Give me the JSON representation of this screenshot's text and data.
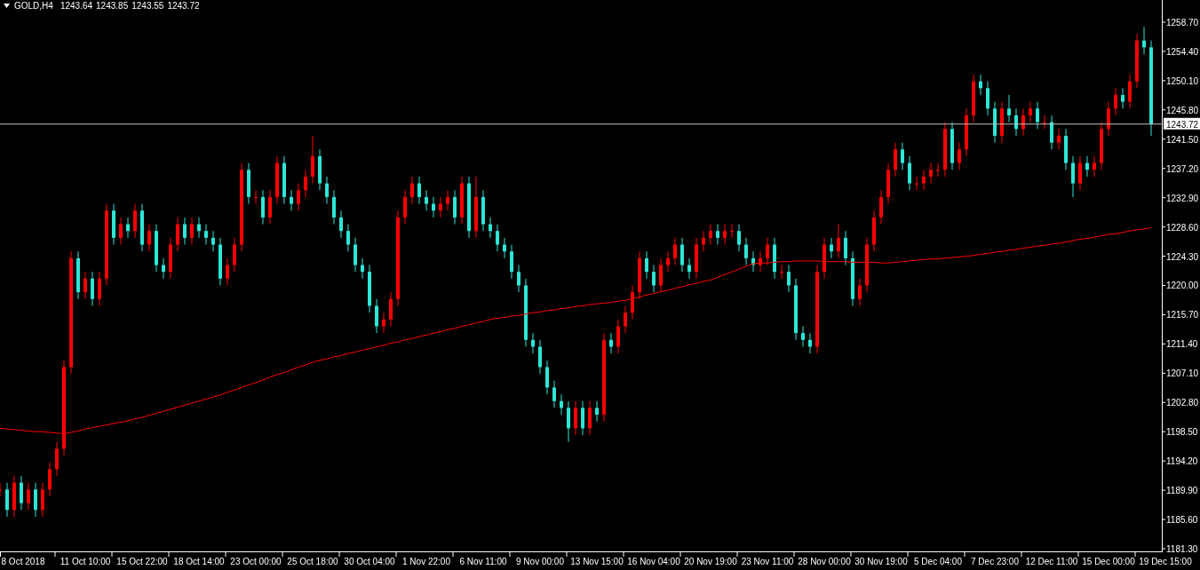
{
  "header": {
    "symbol": "GOLD,H4",
    "quotes": [
      "1243.64",
      "1243.85",
      "1243.55",
      "1243.72"
    ]
  },
  "chart_data": {
    "type": "candlestick",
    "ylim": [
      1180.78,
      1261.96
    ],
    "categories": [
      null,
      null,
      null,
      "8 Oct 2018",
      null,
      null,
      null,
      null,
      null,
      null,
      null,
      null,
      "11 Oct 10:00",
      null,
      null,
      null,
      null,
      null,
      null,
      null,
      "15 Oct 22:00",
      null,
      null,
      null,
      null,
      null,
      null,
      null,
      "18 Oct 14:00",
      null,
      null,
      null,
      null,
      null,
      null,
      null,
      "23 Oct 00:00",
      null,
      null,
      null,
      null,
      null,
      null,
      null,
      "25 Oct 18:00",
      null,
      null,
      null,
      null,
      null,
      null,
      null,
      "30 Oct 04:00",
      null,
      null,
      null,
      null,
      null,
      null,
      null,
      "1 Nov 22:00",
      null,
      null,
      null,
      null,
      null,
      null,
      null,
      "6 Nov 11:00",
      null,
      null,
      null,
      null,
      null,
      null,
      null,
      "9 Nov 00:00",
      null,
      null,
      null,
      null,
      null,
      null,
      null,
      "13 Nov 15:00",
      null,
      null,
      null,
      null,
      null,
      null,
      null,
      "16 Nov 04:00",
      null,
      null,
      null,
      null,
      null,
      null,
      null,
      "20 Nov 19:00",
      null,
      null,
      null,
      null,
      null,
      null,
      null,
      "23 Nov 11:00",
      null,
      null,
      null,
      null,
      null,
      null,
      null,
      "28 Nov 00:00",
      null,
      null,
      null,
      null,
      null,
      null,
      null,
      "30 Nov 19:00",
      null,
      null,
      null,
      null,
      null,
      null,
      null,
      "5 Dec 04:00",
      null,
      null,
      null,
      null,
      null,
      null,
      null,
      "7 Dec 23:00",
      null,
      null,
      null,
      null,
      null,
      null,
      null,
      "12 Dec 11:00",
      null,
      null,
      null,
      null,
      null,
      null,
      null,
      "15 Dec 00:00",
      null,
      null,
      null,
      null,
      null,
      null,
      null,
      "19 Dec 15:00"
    ],
    "ohlc": [
      [
        1190,
        1191,
        1189,
        1190
      ],
      [
        1190,
        1191,
        1186,
        1187
      ],
      [
        1187,
        1192,
        1186,
        1191
      ],
      [
        1191,
        1192,
        1187,
        1188
      ],
      [
        1188,
        1191,
        1187,
        1190
      ],
      [
        1190,
        1191,
        1186,
        1187
      ],
      [
        1187,
        1191,
        1186,
        1190
      ],
      [
        1190,
        1194,
        1189,
        1193
      ],
      [
        1193,
        1197,
        1192,
        1196
      ],
      [
        1196,
        1209,
        1195,
        1208
      ],
      [
        1208,
        1225,
        1207,
        1224
      ],
      [
        1224,
        1225,
        1218,
        1219
      ],
      [
        1219,
        1222,
        1218,
        1221
      ],
      [
        1221,
        1222,
        1217,
        1218
      ],
      [
        1218,
        1222,
        1217,
        1221
      ],
      [
        1221,
        1232,
        1220,
        1231
      ],
      [
        1231,
        1232,
        1226,
        1227
      ],
      [
        1227,
        1230,
        1226,
        1229
      ],
      [
        1229,
        1230,
        1227,
        1228
      ],
      [
        1228,
        1232,
        1227,
        1231
      ],
      [
        1231,
        1232,
        1225,
        1226
      ],
      [
        1226,
        1229,
        1225,
        1228
      ],
      [
        1228,
        1229,
        1222,
        1223
      ],
      [
        1223,
        1224,
        1221,
        1222
      ],
      [
        1222,
        1227,
        1221,
        1226
      ],
      [
        1226,
        1230,
        1225,
        1229
      ],
      [
        1229,
        1230,
        1226,
        1227
      ],
      [
        1227,
        1230,
        1226,
        1229
      ],
      [
        1229,
        1230,
        1227,
        1228
      ],
      [
        1228,
        1229,
        1226,
        1227
      ],
      [
        1227,
        1228,
        1225,
        1226
      ],
      [
        1226,
        1227,
        1220,
        1221
      ],
      [
        1221,
        1224,
        1220,
        1223
      ],
      [
        1223,
        1227,
        1222,
        1226
      ],
      [
        1226,
        1238,
        1225,
        1237
      ],
      [
        1237,
        1238,
        1232,
        1233
      ],
      [
        1233,
        1234,
        1232,
        1233
      ],
      [
        1233,
        1234,
        1229,
        1230
      ],
      [
        1230,
        1234,
        1229,
        1233
      ],
      [
        1233,
        1239,
        1232,
        1238
      ],
      [
        1238,
        1239,
        1232,
        1233
      ],
      [
        1233,
        1234,
        1231,
        1232
      ],
      [
        1232,
        1235,
        1231,
        1234
      ],
      [
        1234,
        1237,
        1233,
        1236
      ],
      [
        1236,
        1242,
        1235,
        1239
      ],
      [
        1239,
        1240,
        1234,
        1235
      ],
      [
        1235,
        1236,
        1232,
        1233
      ],
      [
        1233,
        1234,
        1229,
        1230
      ],
      [
        1230,
        1231,
        1227,
        1228
      ],
      [
        1228,
        1229,
        1225,
        1226
      ],
      [
        1226,
        1227,
        1222,
        1223
      ],
      [
        1223,
        1224,
        1221,
        1222
      ],
      [
        1222,
        1223,
        1216,
        1217
      ],
      [
        1217,
        1218,
        1213,
        1214
      ],
      [
        1214,
        1216,
        1213,
        1215
      ],
      [
        1215,
        1219,
        1214,
        1218
      ],
      [
        1218,
        1231,
        1217,
        1230
      ],
      [
        1230,
        1234,
        1229,
        1233
      ],
      [
        1233,
        1236,
        1232,
        1235
      ],
      [
        1235,
        1236,
        1232,
        1233
      ],
      [
        1233,
        1234,
        1231,
        1232
      ],
      [
        1232,
        1233,
        1230,
        1231
      ],
      [
        1231,
        1233,
        1230,
        1232
      ],
      [
        1232,
        1234,
        1231,
        1233
      ],
      [
        1233,
        1234,
        1229,
        1230
      ],
      [
        1230,
        1236,
        1229,
        1235
      ],
      [
        1235,
        1236,
        1227,
        1228
      ],
      [
        1228,
        1236,
        1227,
        1233
      ],
      [
        1233,
        1234,
        1228,
        1229
      ],
      [
        1229,
        1230,
        1227,
        1228
      ],
      [
        1228,
        1229,
        1225,
        1226
      ],
      [
        1226,
        1227,
        1224,
        1225
      ],
      [
        1225,
        1226,
        1221,
        1222
      ],
      [
        1222,
        1223,
        1219,
        1220
      ],
      [
        1220,
        1221,
        1211,
        1212
      ],
      [
        1212,
        1213,
        1210,
        1211
      ],
      [
        1211,
        1212,
        1207,
        1208
      ],
      [
        1208,
        1209,
        1204,
        1205
      ],
      [
        1205,
        1206,
        1202,
        1203
      ],
      [
        1203,
        1204,
        1201,
        1202
      ],
      [
        1202,
        1203,
        1197,
        1199
      ],
      [
        1199,
        1203,
        1198,
        1202
      ],
      [
        1202,
        1203,
        1198,
        1199
      ],
      [
        1199,
        1203,
        1198,
        1202
      ],
      [
        1202,
        1203,
        1200,
        1201
      ],
      [
        1201,
        1213,
        1200,
        1212
      ],
      [
        1212,
        1213,
        1210,
        1211
      ],
      [
        1211,
        1215,
        1210,
        1214
      ],
      [
        1214,
        1217,
        1213,
        1216
      ],
      [
        1216,
        1220,
        1215,
        1219
      ],
      [
        1219,
        1225,
        1218,
        1224
      ],
      [
        1224,
        1225,
        1221,
        1222
      ],
      [
        1222,
        1223,
        1219,
        1220
      ],
      [
        1220,
        1224,
        1219,
        1223
      ],
      [
        1223,
        1225,
        1222,
        1224
      ],
      [
        1224,
        1227,
        1223,
        1226
      ],
      [
        1226,
        1227,
        1222,
        1223
      ],
      [
        1223,
        1224,
        1221,
        1222
      ],
      [
        1222,
        1227,
        1221,
        1226
      ],
      [
        1226,
        1228,
        1225,
        1227
      ],
      [
        1227,
        1229,
        1226,
        1228
      ],
      [
        1228,
        1229,
        1226,
        1227
      ],
      [
        1227,
        1229,
        1226,
        1228
      ],
      [
        1228,
        1229,
        1227,
        1228
      ],
      [
        1228,
        1229,
        1225,
        1226
      ],
      [
        1226,
        1227,
        1223,
        1224
      ],
      [
        1224,
        1225,
        1222,
        1223
      ],
      [
        1223,
        1225,
        1222,
        1224
      ],
      [
        1224,
        1227,
        1223,
        1226
      ],
      [
        1226,
        1227,
        1221,
        1222
      ],
      [
        1222,
        1223,
        1221,
        1222
      ],
      [
        1222,
        1223,
        1219,
        1220
      ],
      [
        1220,
        1221,
        1212,
        1213
      ],
      [
        1213,
        1214,
        1211,
        1212
      ],
      [
        1212,
        1213,
        1210,
        1211
      ],
      [
        1211,
        1223,
        1210,
        1222
      ],
      [
        1222,
        1227,
        1221,
        1226
      ],
      [
        1226,
        1227,
        1224,
        1225
      ],
      [
        1225,
        1229,
        1224,
        1227
      ],
      [
        1227,
        1228,
        1223,
        1224
      ],
      [
        1224,
        1225,
        1217,
        1218
      ],
      [
        1218,
        1221,
        1217,
        1220
      ],
      [
        1220,
        1227,
        1219,
        1226
      ],
      [
        1226,
        1231,
        1225,
        1230
      ],
      [
        1230,
        1234,
        1229,
        1233
      ],
      [
        1233,
        1238,
        1232,
        1237
      ],
      [
        1237,
        1241,
        1236,
        1240
      ],
      [
        1240,
        1241,
        1237,
        1238
      ],
      [
        1238,
        1239,
        1234,
        1235
      ],
      [
        1235,
        1236,
        1234,
        1235
      ],
      [
        1235,
        1237,
        1234,
        1236
      ],
      [
        1236,
        1238,
        1235,
        1237
      ],
      [
        1237,
        1238,
        1236,
        1237
      ],
      [
        1237,
        1244,
        1236,
        1243
      ],
      [
        1243,
        1244,
        1237,
        1238
      ],
      [
        1238,
        1241,
        1237,
        1240
      ],
      [
        1240,
        1246,
        1239,
        1245
      ],
      [
        1245,
        1251,
        1244,
        1250
      ],
      [
        1250,
        1251,
        1248,
        1249
      ],
      [
        1249,
        1250,
        1245,
        1246
      ],
      [
        1246,
        1247,
        1241,
        1242
      ],
      [
        1242,
        1247,
        1241,
        1246
      ],
      [
        1246,
        1248,
        1244,
        1245
      ],
      [
        1245,
        1246,
        1242,
        1243
      ],
      [
        1243,
        1246,
        1242,
        1245
      ],
      [
        1245,
        1247,
        1244,
        1246
      ],
      [
        1246,
        1247,
        1243,
        1244
      ],
      [
        1244,
        1245,
        1243,
        1244
      ],
      [
        1244,
        1245,
        1240,
        1241
      ],
      [
        1241,
        1243,
        1240,
        1242
      ],
      [
        1242,
        1243,
        1237,
        1238
      ],
      [
        1238,
        1239,
        1233,
        1235
      ],
      [
        1235,
        1239,
        1234,
        1238
      ],
      [
        1238,
        1239,
        1236,
        1237
      ],
      [
        1237,
        1239,
        1236,
        1238
      ],
      [
        1238,
        1244,
        1237,
        1243
      ],
      [
        1243,
        1247,
        1242,
        1246
      ],
      [
        1246,
        1249,
        1245,
        1248
      ],
      [
        1248,
        1249,
        1246,
        1247
      ],
      [
        1247,
        1251,
        1246,
        1250
      ],
      [
        1250,
        1257,
        1249,
        1256
      ],
      [
        1256,
        1258,
        1254,
        1255
      ],
      [
        1255,
        1256,
        1242,
        1243.7
      ],
      null,
      null
    ],
    "series": [
      {
        "type": "line",
        "color": "#ff0000",
        "values": [
          1199.0,
          1198.9,
          1198.8,
          1198.7,
          1198.6,
          1198.5,
          1198.5,
          1198.4,
          1198.3,
          1198.2,
          1198.4,
          1198.6,
          1198.9,
          1199.1,
          1199.3,
          1199.5,
          1199.7,
          1199.9,
          1200.1,
          1200.4,
          1200.6,
          1200.9,
          1201.2,
          1201.5,
          1201.8,
          1202.1,
          1202.4,
          1202.7,
          1203.0,
          1203.3,
          1203.6,
          1203.9,
          1204.3,
          1204.6,
          1205.0,
          1205.4,
          1205.7,
          1206.1,
          1206.5,
          1206.9,
          1207.2,
          1207.6,
          1208.0,
          1208.3,
          1208.7,
          1209.0,
          1209.2,
          1209.5,
          1209.7,
          1210.0,
          1210.2,
          1210.5,
          1210.7,
          1211.0,
          1211.2,
          1211.5,
          1211.7,
          1212.0,
          1212.2,
          1212.5,
          1212.7,
          1213.0,
          1213.2,
          1213.5,
          1213.7,
          1214.0,
          1214.2,
          1214.5,
          1214.7,
          1215.0,
          1215.2,
          1215.3,
          1215.5,
          1215.6,
          1215.8,
          1216.0,
          1216.1,
          1216.3,
          1216.4,
          1216.6,
          1216.7,
          1216.9,
          1217.0,
          1217.2,
          1217.3,
          1217.4,
          1217.5,
          1217.7,
          1217.8,
          1218.1,
          1218.3,
          1218.6,
          1218.8,
          1219.1,
          1219.3,
          1219.6,
          1219.8,
          1220.1,
          1220.3,
          1220.6,
          1220.8,
          1221.2,
          1221.6,
          1222.0,
          1222.4,
          1222.8,
          1223.2,
          1223.3,
          1223.3,
          1223.4,
          1223.5,
          1223.5,
          1223.6,
          1223.6,
          1223.6,
          1223.6,
          1223.5,
          1223.5,
          1223.5,
          1223.5,
          1223.4,
          1223.4,
          1223.4,
          1223.4,
          1223.3,
          1223.3,
          1223.4,
          1223.5,
          1223.6,
          1223.7,
          1223.8,
          1223.9,
          1223.9,
          1224.0,
          1224.1,
          1224.2,
          1224.3,
          1224.4,
          1224.6,
          1224.7,
          1224.9,
          1225.0,
          1225.2,
          1225.3,
          1225.5,
          1225.6,
          1225.8,
          1225.9,
          1226.1,
          1226.2,
          1226.4,
          1226.6,
          1226.8,
          1226.9,
          1227.1,
          1227.3,
          1227.5,
          1227.6,
          1227.8,
          1228.0,
          1228.2,
          1228.3,
          1228.5,
          null,
          null
        ]
      }
    ],
    "yticks": [
      {
        "value": 1258.7,
        "label": "1258.70"
      },
      {
        "value": 1254.4,
        "label": "1254.40"
      },
      {
        "value": 1250.1,
        "label": "1250.10"
      },
      {
        "value": 1245.8,
        "label": "1245.80"
      },
      {
        "value": 1241.5,
        "label": "1241.50"
      },
      {
        "value": 1237.2,
        "label": "1237.20"
      },
      {
        "value": 1232.9,
        "label": "1232.90"
      },
      {
        "value": 1228.6,
        "label": "1228.60"
      },
      {
        "value": 1224.3,
        "label": "1224.30"
      },
      {
        "value": 1220.0,
        "label": "1220.00"
      },
      {
        "value": 1215.7,
        "label": "1215.70"
      },
      {
        "value": 1211.4,
        "label": "1211.40"
      },
      {
        "value": 1207.1,
        "label": "1207.10"
      },
      {
        "value": 1202.8,
        "label": "1202.80"
      },
      {
        "value": 1198.5,
        "label": "1198.50"
      },
      {
        "value": 1194.2,
        "label": "1194.20"
      },
      {
        "value": 1189.9,
        "label": "1189.90"
      },
      {
        "value": 1185.6,
        "label": "1185.60"
      },
      {
        "value": 1181.3,
        "label": "1181.30"
      }
    ],
    "ref_lines": [
      {
        "axis": "y",
        "value": 1243.72,
        "label": "1243.72"
      }
    ]
  }
}
